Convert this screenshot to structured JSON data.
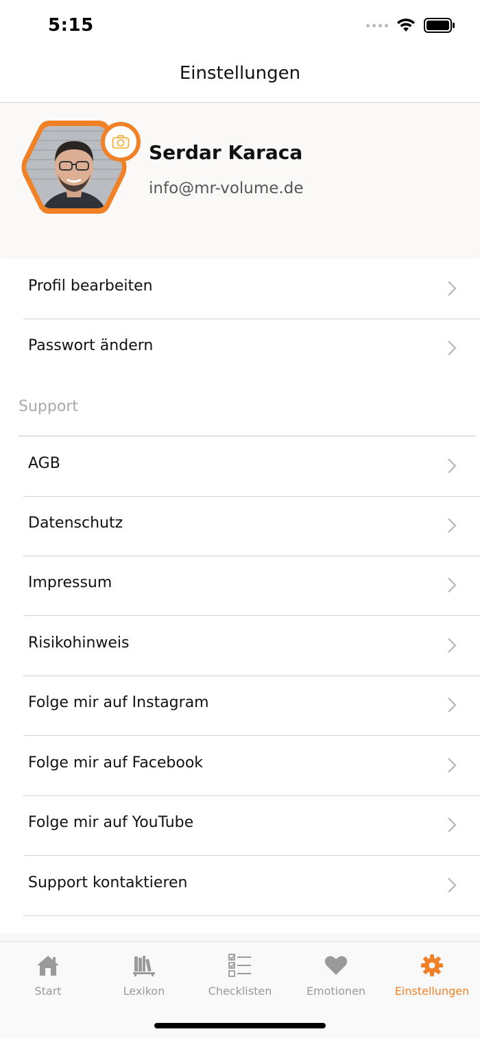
{
  "status_bar": {
    "time": "5:15"
  },
  "nav": {
    "title": "Einstellungen"
  },
  "profile": {
    "name": "Serdar Karaca",
    "email": "info@mr-volume.de",
    "accent_color": "#f08126",
    "avatar_icon": "person-photo",
    "camera_icon": "camera-icon"
  },
  "menu": {
    "account_items": [
      {
        "label": "Profil bearbeiten"
      },
      {
        "label": "Passwort ändern"
      }
    ],
    "support_header": "Support",
    "support_items": [
      {
        "label": "AGB"
      },
      {
        "label": "Datenschutz"
      },
      {
        "label": "Impressum"
      },
      {
        "label": "Risikohinweis"
      },
      {
        "label": "Folge mir auf Instagram"
      },
      {
        "label": "Folge mir auf Facebook"
      },
      {
        "label": "Folge mir auf YouTube"
      },
      {
        "label": "Support kontaktieren"
      }
    ]
  },
  "tabs": [
    {
      "label": "Start",
      "icon": "home-icon",
      "active": false
    },
    {
      "label": "Lexikon",
      "icon": "books-icon",
      "active": false
    },
    {
      "label": "Checklisten",
      "icon": "checklist-icon",
      "active": false
    },
    {
      "label": "Emotionen",
      "icon": "heart-icon",
      "active": false
    },
    {
      "label": "Einstellungen",
      "icon": "gear-icon",
      "active": true
    }
  ],
  "colors": {
    "accent": "#f08126",
    "inactive_tab": "#9a9a9a"
  }
}
